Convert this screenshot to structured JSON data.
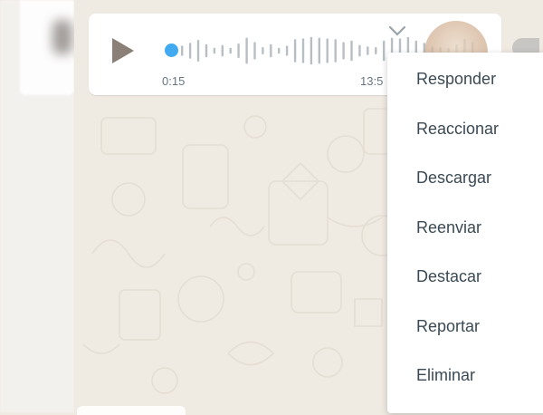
{
  "voice_message": {
    "elapsed": "0:15",
    "sent_time": "13:5",
    "waveform": [
      0.35,
      0.55,
      0.75,
      0.45,
      0.2,
      0.4,
      0.2,
      0.5,
      0.9,
      0.6,
      0.25,
      0.45,
      0.2,
      0.35,
      0.8,
      0.85,
      0.95,
      0.9,
      0.85,
      0.8,
      0.6,
      0.7,
      0.4,
      0.3,
      0.25,
      0.7,
      0.9,
      0.85,
      0.95,
      0.7,
      0.55,
      0.3,
      0.25,
      0.2,
      0.45,
      0.8,
      0.6
    ]
  },
  "context_menu": {
    "items": [
      {
        "label": "Responder",
        "name": "menu-item-reply"
      },
      {
        "label": "Reaccionar",
        "name": "menu-item-react"
      },
      {
        "label": "Descargar",
        "name": "menu-item-download"
      },
      {
        "label": "Reenviar",
        "name": "menu-item-forward"
      },
      {
        "label": "Destacar",
        "name": "menu-item-star"
      },
      {
        "label": "Reportar",
        "name": "menu-item-report"
      },
      {
        "label": "Eliminar",
        "name": "menu-item-delete"
      }
    ]
  },
  "colors": {
    "chat_background": "#efeae2",
    "waveform_bar": "#b7bfc4",
    "progress_dot": "#42aaf0",
    "menu_text": "#3b4a54"
  }
}
